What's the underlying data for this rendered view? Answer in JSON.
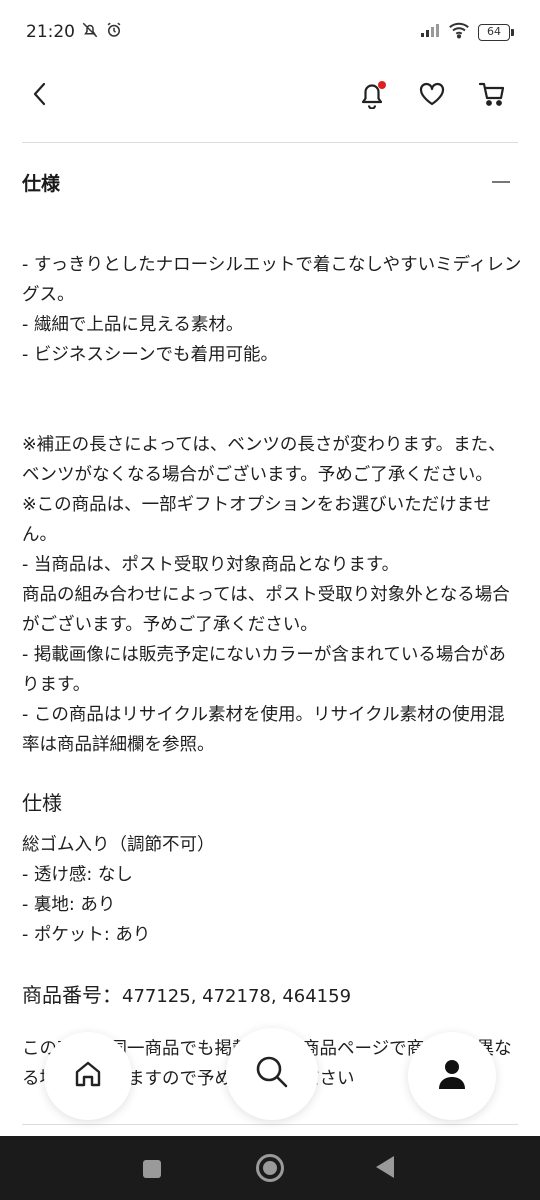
{
  "status_bar": {
    "time": "21:20",
    "battery": "64"
  },
  "header": {
    "icons": [
      "back-chevron-icon",
      "bell-icon",
      "heart-icon",
      "cart-icon"
    ],
    "notification_dot_color": "#e02020"
  },
  "section": {
    "title": "仕様",
    "toggle": "—"
  },
  "description": {
    "bullets_1": "- すっきりとしたナローシルエットで着こなしやすいミディレングス。\n- 繊細で上品に見える素材。\n- ビジネスシーンでも着用可能。",
    "notes": "※補正の長さによっては、ベンツの長さが変わります。また、ベンツがなくなる場合がございます。予めご了承ください。\n※この商品は、一部ギフトオプションをお選びいただけません。\n- 当商品は、ポスト受取り対象商品となります。\n商品の組み合わせによっては、ポスト受取り対象外となる場合がございます。予めご了承ください。\n- 掲載画像には販売予定にないカラーが含まれている場合があります。\n- この商品はリサイクル素材を使用。リサイクル素材の使用混率は商品詳細欄を参照。"
  },
  "spec": {
    "title": "仕様",
    "body": "総ゴム入り（調節不可）\n- 透け感: なし\n- 裏地: あり\n- ポケット: あり"
  },
  "product_number": {
    "label": "商品番号：",
    "values": "477125, 472178, 464159"
  },
  "footer_note": "この商品は同一商品でも掲載される商品ページで商品名が異なる場合がありますので予めご了承ください",
  "floating_nav": {
    "icons": [
      "home-icon",
      "search-icon",
      "user-icon"
    ]
  }
}
